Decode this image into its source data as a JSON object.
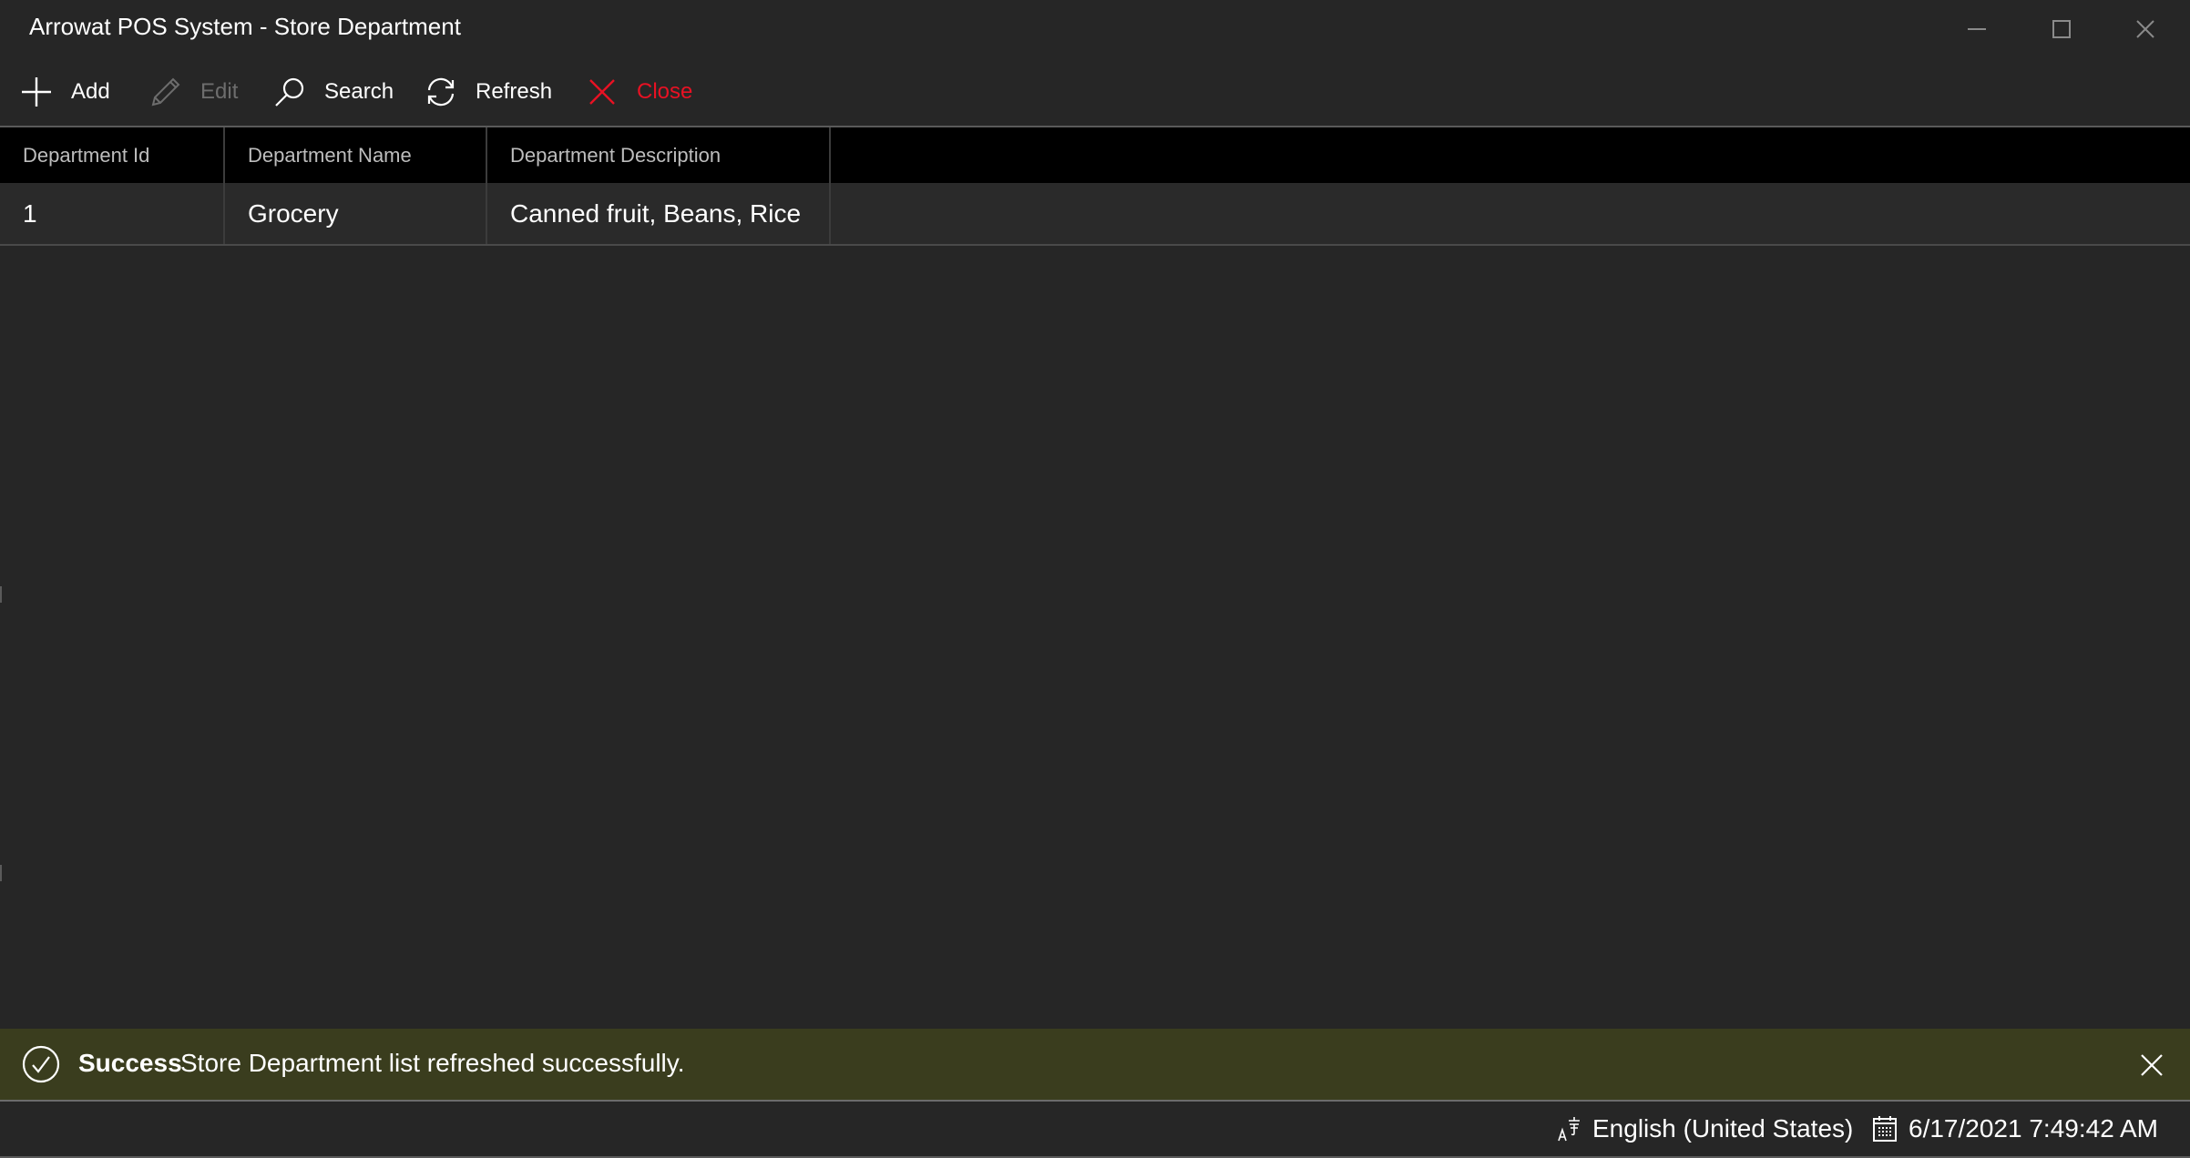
{
  "window": {
    "title": "Arrowat POS System - Store Department",
    "controls": [
      "minimize",
      "maximize",
      "close"
    ]
  },
  "toolbar": {
    "buttons": [
      {
        "label": "Add",
        "icon": "plus-icon",
        "state": "enabled"
      },
      {
        "label": "Edit",
        "icon": "pencil-icon",
        "state": "disabled"
      },
      {
        "label": "Search",
        "icon": "search-icon",
        "state": "enabled"
      },
      {
        "label": "Refresh",
        "icon": "refresh-icon",
        "state": "enabled"
      },
      {
        "label": "Close",
        "icon": "close-icon",
        "state": "enabled"
      }
    ]
  },
  "grid": {
    "columns": [
      "Department Id",
      "Department Name",
      "Department Description"
    ],
    "rows": [
      [
        "1",
        "Grocery",
        "Canned fruit, Beans, Rice"
      ]
    ]
  },
  "notification": {
    "type": "success",
    "icon": "check-circle-icon",
    "title": "Success",
    "message": "Store Department list refreshed successfully."
  },
  "statusbar": {
    "language": "English (United States)",
    "datetime": "6/17/2021 7:49:42 AM"
  },
  "colors": {
    "background": "#262626",
    "grid_header": "#000000",
    "notification_success": "#3a3d1e",
    "danger": "#e81123",
    "disabled": "#6d6d6d"
  }
}
